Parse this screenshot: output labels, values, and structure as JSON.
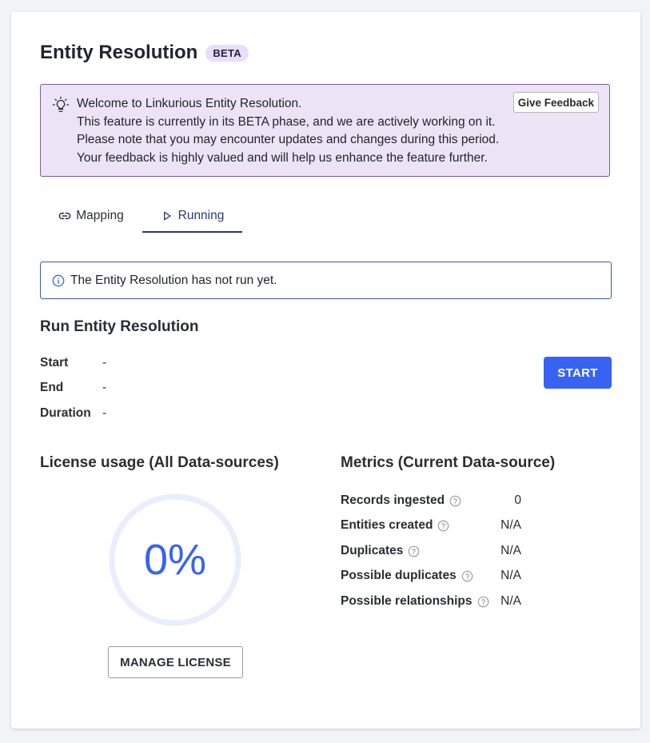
{
  "header": {
    "title": "Entity Resolution",
    "badge": "BETA"
  },
  "banner": {
    "icon": "lightbulb-icon",
    "lines": [
      "Welcome to Linkurious Entity Resolution.",
      "This feature is currently in its BETA phase, and we are actively working on it.",
      "Please note that you may encounter updates and changes during this period.",
      "Your feedback is highly valued and will help us enhance the feature further."
    ],
    "feedback_label": "Give Feedback"
  },
  "tabs": [
    {
      "label": "Mapping",
      "icon": "link-icon",
      "active": false
    },
    {
      "label": "Running",
      "icon": "play-icon",
      "active": true
    }
  ],
  "alert": {
    "icon": "info-icon",
    "message": "The Entity Resolution has not run yet."
  },
  "run": {
    "title": "Run Entity Resolution",
    "rows": [
      {
        "label": "Start",
        "value": "-"
      },
      {
        "label": "End",
        "value": "-"
      },
      {
        "label": "Duration",
        "value": "-"
      }
    ],
    "start_label": "START"
  },
  "license": {
    "title": "License usage (All Data-sources)",
    "percent_text": "0%",
    "usage_fraction": 0,
    "manage_label": "MANAGE LICENSE"
  },
  "metrics": {
    "title": "Metrics (Current Data-source)",
    "rows": [
      {
        "label": "Records ingested",
        "value": "0"
      },
      {
        "label": "Entities created",
        "value": "N/A"
      },
      {
        "label": "Duplicates",
        "value": "N/A"
      },
      {
        "label": "Possible duplicates",
        "value": "N/A"
      },
      {
        "label": "Possible relationships",
        "value": "N/A"
      }
    ]
  },
  "colors": {
    "accent": "#3863f2",
    "banner_bg": "#ece4f4",
    "banner_border": "#7d5a9a",
    "badge_bg": "#e6defa",
    "tab_active": "#2b3a6b",
    "gauge_track": "#e8eefc"
  }
}
